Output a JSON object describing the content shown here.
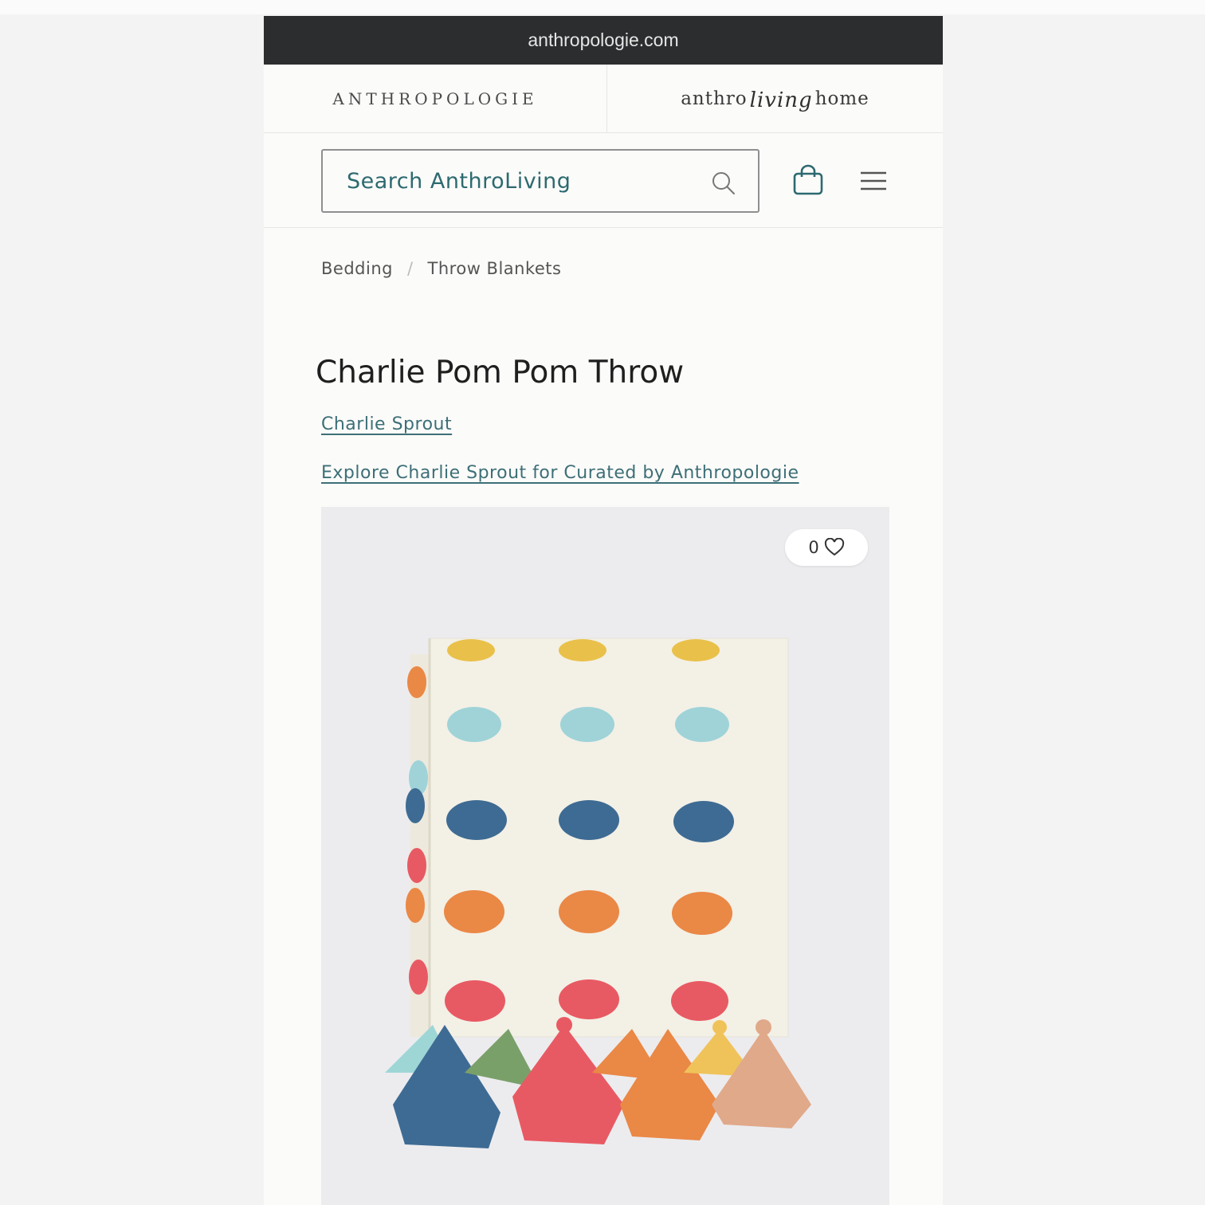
{
  "browser": {
    "url": "anthropologie.com"
  },
  "brands": {
    "left": "ANTHROPOLOGIE",
    "right_prefix": "anthro",
    "right_script": "living",
    "right_suffix": "home"
  },
  "search": {
    "placeholder": "Search AnthroLiving"
  },
  "icons": {
    "search": "search-icon",
    "bag": "shopping-bag-icon",
    "menu": "hamburger-menu-icon",
    "heart": "heart-icon"
  },
  "breadcrumb": {
    "items": [
      "Bedding",
      "Throw Blankets"
    ],
    "separator": "/"
  },
  "product": {
    "title": "Charlie Pom Pom Throw",
    "brand_link": "Charlie Sprout",
    "explore_link": "Explore Charlie Sprout for Curated by Anthropologie",
    "favorites_count": "0"
  },
  "colors": {
    "url_bar": "#2b2d2f",
    "link": "#3d6f77",
    "pom_rows": [
      "#e9c14a",
      "#9fd3d8",
      "#3e6b93",
      "#ea8846",
      "#e85a63"
    ],
    "tassels": [
      "#9ed6d6",
      "#3e6b93",
      "#7aa06a",
      "#e85a63",
      "#ea8846",
      "#f0c35a",
      "#e0a98a"
    ]
  }
}
